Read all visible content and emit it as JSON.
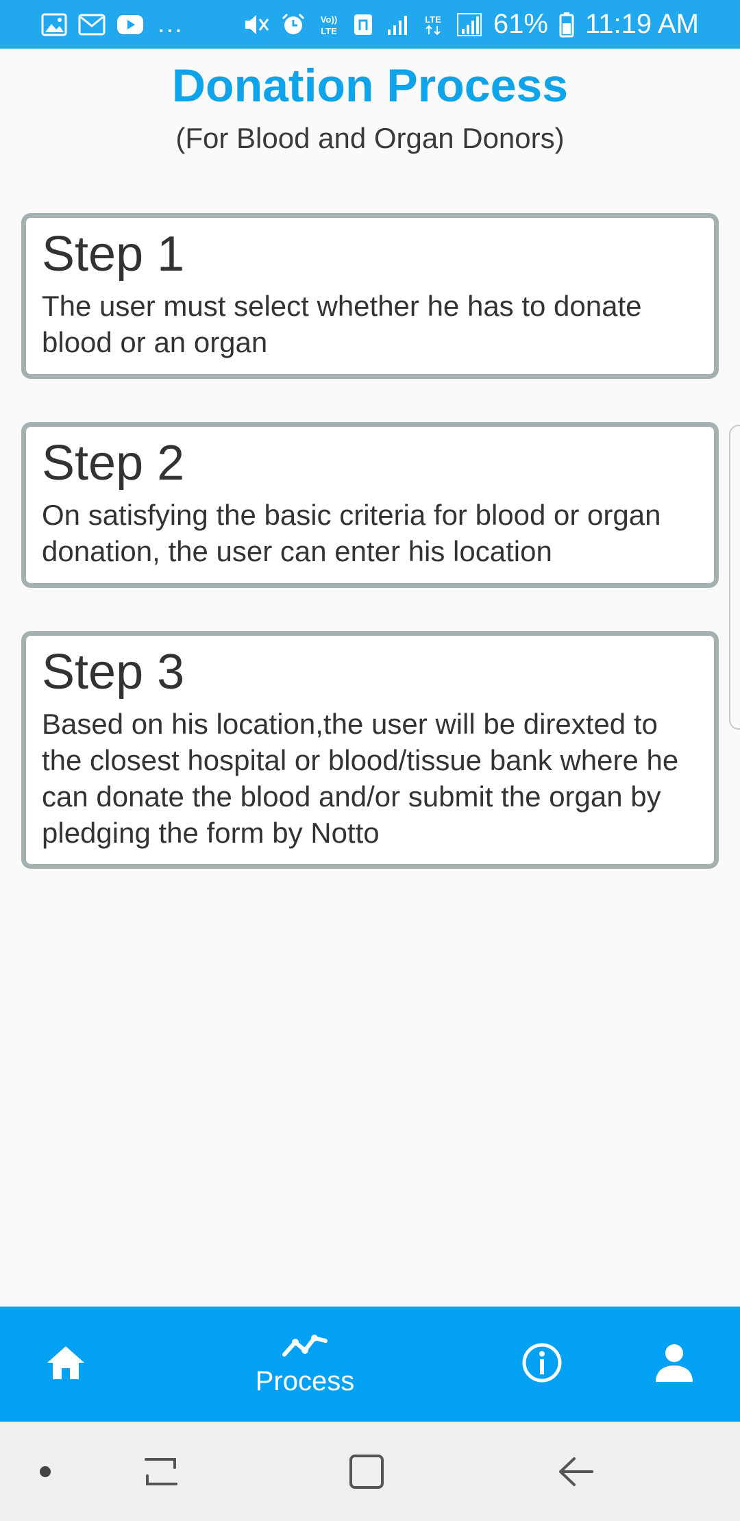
{
  "status_bar": {
    "notification_icons": [
      "gallery-icon",
      "gmail-icon",
      "youtube-icon"
    ],
    "more_indicator": "...",
    "system_icons": [
      "mute-icon",
      "alarm-icon",
      "volte-icon",
      "nfc-icon",
      "signal-icon",
      "lte-icon",
      "signal-icon"
    ],
    "battery_percent": "61%",
    "time": "11:19 AM"
  },
  "header": {
    "title": "Donation Process",
    "subtitle": "(For Blood and Organ Donors)"
  },
  "steps": [
    {
      "title": "Step 1",
      "description": "The user must select whether he has to donate blood or an organ"
    },
    {
      "title": "Step 2",
      "description": "On satisfying the basic criteria for blood or organ donation, the user can enter his location"
    },
    {
      "title": "Step 3",
      "description": "Based on his location,the user will be direxted to the closest hospital or blood/tissue bank where he can donate the blood and/or submit the organ by pledging the form by Notto"
    }
  ],
  "bottom_nav": {
    "items": [
      {
        "icon": "home-icon",
        "label": ""
      },
      {
        "icon": "process-chart-icon",
        "label": "Process",
        "active": true
      },
      {
        "icon": "info-icon",
        "label": ""
      },
      {
        "icon": "person-icon",
        "label": ""
      }
    ]
  },
  "system_nav": [
    "dot-icon",
    "recents-icon",
    "home-square-icon",
    "back-icon"
  ],
  "colors": {
    "accent": "#02a1f4",
    "title": "#0fa3ea",
    "card_border": "#a4b1b1",
    "background": "#fafafa"
  }
}
